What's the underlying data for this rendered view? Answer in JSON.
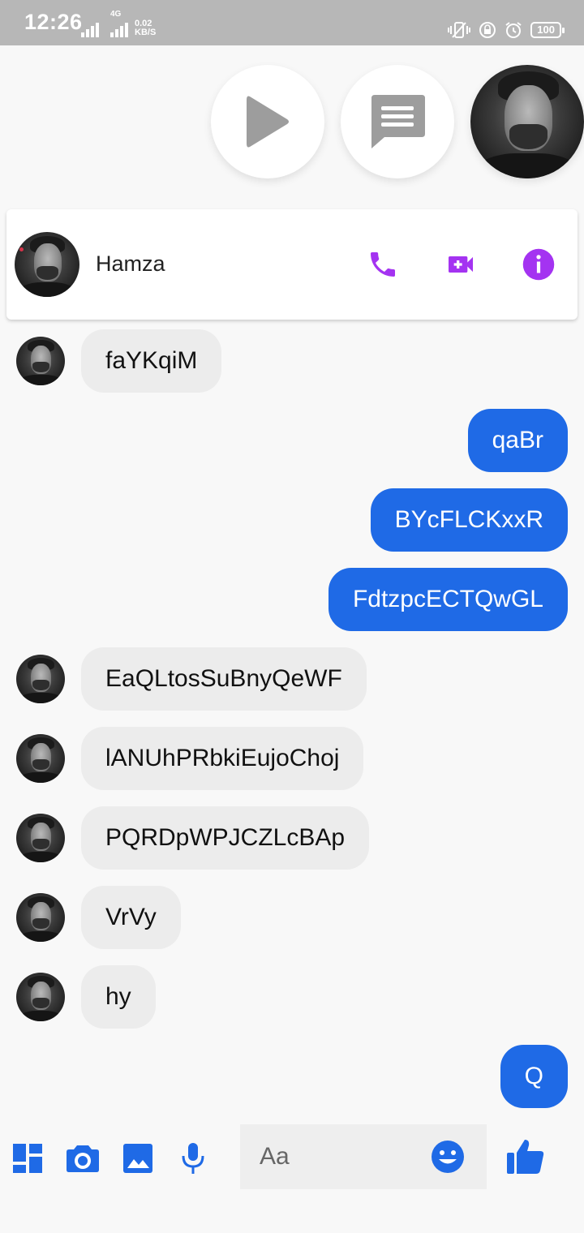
{
  "status_bar": {
    "time": "12:26",
    "net_speed_value": "0.02",
    "net_speed_unit": "KB/S",
    "network_type": "4G",
    "battery": "100"
  },
  "floating_bubbles": [
    {
      "name": "play",
      "icon": "play-icon"
    },
    {
      "name": "messages",
      "icon": "message-icon"
    },
    {
      "name": "contact-avatar",
      "icon": "avatar"
    }
  ],
  "header": {
    "contact_name": "Hamza",
    "actions": [
      {
        "name": "call",
        "icon": "phone-icon"
      },
      {
        "name": "video",
        "icon": "video-call-icon"
      },
      {
        "name": "info",
        "icon": "info-icon"
      }
    ],
    "accent_color": "#a433f1"
  },
  "messages": [
    {
      "direction": "in",
      "text": "faYKqiM"
    },
    {
      "direction": "out",
      "text": "qaBr"
    },
    {
      "direction": "out",
      "text": "BYcFLCKxxR"
    },
    {
      "direction": "out",
      "text": "FdtzpcECTQwGL"
    },
    {
      "direction": "in",
      "text": "EaQLtosSuBnyQeWF"
    },
    {
      "direction": "in",
      "text": "lANUhPRbkiEujoChoj"
    },
    {
      "direction": "in",
      "text": "PQRDpWPJCZLcBAp"
    },
    {
      "direction": "in",
      "text": "VrVy"
    },
    {
      "direction": "in",
      "text": "hy"
    },
    {
      "direction": "out",
      "text": "Q"
    }
  ],
  "composer": {
    "placeholder": "Aa",
    "value": ""
  },
  "bottom_bar": {
    "icons": [
      "grid-icon",
      "camera-icon",
      "gallery-icon",
      "mic-icon",
      "emoji-icon",
      "thumbs-up-icon"
    ],
    "accent_color": "#1f6ae6"
  }
}
